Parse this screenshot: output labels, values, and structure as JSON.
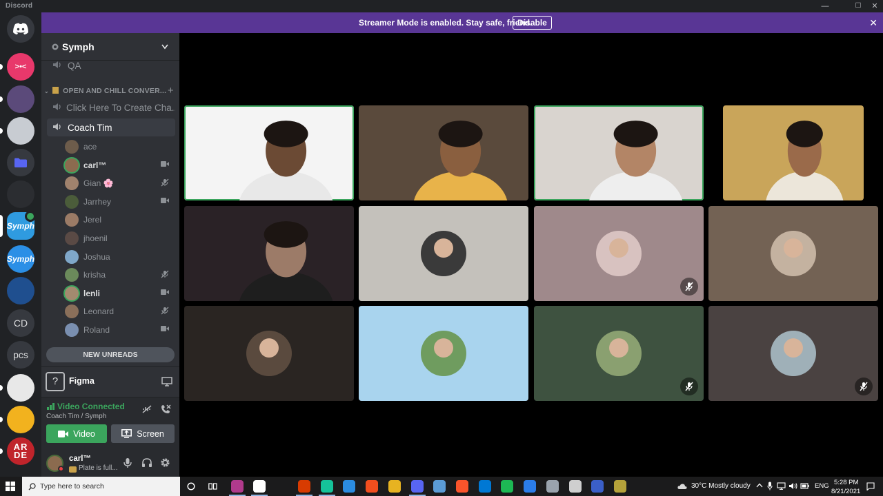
{
  "window": {
    "title": "Discord"
  },
  "banner": {
    "message": "Streamer Mode is enabled. Stay safe, friend.",
    "button_label": "Disable"
  },
  "rail": {
    "servers": [
      {
        "name": "Home",
        "icon": "discord-logo-icon",
        "color": "#36393f"
      },
      {
        "name": "server-pink",
        "color": "#e8386b"
      },
      {
        "name": "server-art",
        "color": "#5b4a7a"
      },
      {
        "name": "server-bird",
        "color": "#c8ccd2"
      },
      {
        "name": "server-folder",
        "icon": "folder-icon",
        "color": "#36393f"
      },
      {
        "name": "server-dark",
        "color": "#2b2d31"
      },
      {
        "name": "Symph",
        "color": "#2f9be0"
      },
      {
        "name": "Symph & friends",
        "color": "#2b8fe6"
      },
      {
        "name": "server-blue",
        "color": "#1f4f8f"
      },
      {
        "name": "CD",
        "label": "CD",
        "color": "#36393f"
      },
      {
        "name": "pcs",
        "label": "pcs",
        "color": "#36393f"
      },
      {
        "name": "server-circle",
        "color": "#e8e8e8"
      },
      {
        "name": "server-yellow",
        "color": "#f2b21e"
      },
      {
        "name": "ARDE",
        "label": "AR DE",
        "color": "#c0242b"
      }
    ]
  },
  "sidebar": {
    "guild_name": "Symph",
    "channel_qa": "QA",
    "category": "OPEN AND CHILL CONVER...",
    "channel_create": "Click Here To Create Cha...",
    "channel_active": "Coach Tim",
    "members": [
      {
        "name": "ace",
        "status": "none",
        "color": "#6d5c4b"
      },
      {
        "name": "carl™",
        "status": "video",
        "live": true,
        "color": "#8b6b4f"
      },
      {
        "name": "Gian 🌸",
        "status": "muted",
        "color": "#a0826d"
      },
      {
        "name": "Jarrhey",
        "status": "video",
        "color": "#4b5c3a"
      },
      {
        "name": "Jerel",
        "status": "none",
        "color": "#9b7b66"
      },
      {
        "name": "jhoenil",
        "status": "none",
        "color": "#5a4a45"
      },
      {
        "name": "Joshua",
        "status": "none",
        "color": "#7fa7c9"
      },
      {
        "name": "krisha",
        "status": "muted",
        "color": "#6b8a5b"
      },
      {
        "name": "lenli",
        "status": "video",
        "live": true,
        "color": "#a38a6f"
      },
      {
        "name": "Leonard",
        "status": "muted",
        "color": "#8a6f5a"
      },
      {
        "name": "Roland",
        "status": "video",
        "color": "#7a8fb0"
      }
    ],
    "new_unreads": "NEW UNREADS",
    "activity": {
      "name": "Figma"
    },
    "voice": {
      "status": "Video Connected",
      "location": "Coach Tim / Symph",
      "video_label": "Video",
      "screen_label": "Screen"
    },
    "user": {
      "name": "carl™",
      "custom_status": "Plate is full..."
    }
  },
  "tiles": [
    {
      "kind": "camera",
      "speaking": true,
      "bg": "#f4f4f4",
      "skin": "#6b4a34",
      "shirt": "#e8e8e8"
    },
    {
      "kind": "camera",
      "speaking": false,
      "bg": "#5a4a3c",
      "skin": "#8a5f3f",
      "shirt": "#e8b34a"
    },
    {
      "kind": "camera",
      "speaking": true,
      "bg": "#d9d4cf",
      "skin": "#b38566",
      "shirt": "#eeeeee"
    },
    {
      "kind": "camera",
      "speaking": false,
      "bg": "#c9a55a",
      "skin": "#9a6a4a",
      "shirt": "#ece6da"
    },
    {
      "kind": "camera",
      "speaking": false,
      "bg": "#2a2226",
      "skin": "#9c7b68",
      "shirt": "#1e1e1e"
    },
    {
      "kind": "avatar",
      "bg": "#c4c1bb",
      "avatar": "#3a3a3a",
      "muted": false
    },
    {
      "kind": "avatar",
      "bg": "#9f898b",
      "avatar": "#d8c2c0",
      "muted": true
    },
    {
      "kind": "avatar",
      "bg": "#736254",
      "avatar": "#c4b2a0",
      "muted": false
    },
    {
      "kind": "avatar",
      "bg": "#2a2522",
      "avatar": "#5a4a3e",
      "muted": false
    },
    {
      "kind": "avatar",
      "bg": "#a9d4ee",
      "avatar": "#6f9c5f",
      "muted": false
    },
    {
      "kind": "avatar",
      "bg": "#3e5240",
      "avatar": "#8aa070",
      "muted": true
    },
    {
      "kind": "avatar",
      "bg": "#4a4241",
      "avatar": "#9fb0b8",
      "muted": true
    }
  ],
  "taskbar": {
    "search_placeholder": "Type here to search",
    "apps": [
      {
        "name": "app-1",
        "color": "#b03a8c"
      },
      {
        "name": "notion",
        "color": "#ffffff"
      },
      {
        "name": "office",
        "color": "#d83b01"
      },
      {
        "name": "grammarly",
        "color": "#15c39a"
      },
      {
        "name": "vscode",
        "color": "#2b8ce0"
      },
      {
        "name": "figma",
        "color": "#f24e1e"
      },
      {
        "name": "chrome",
        "color": "#e7b321"
      },
      {
        "name": "discord",
        "color": "#5865f2"
      },
      {
        "name": "app-9",
        "color": "#5b9bd5"
      },
      {
        "name": "brave",
        "color": "#fb542b"
      },
      {
        "name": "mail",
        "color": "#0078d4"
      },
      {
        "name": "spotify",
        "color": "#1db954"
      },
      {
        "name": "calendar",
        "color": "#2b7de9"
      },
      {
        "name": "app-14",
        "color": "#9aa3ad"
      },
      {
        "name": "app-15",
        "color": "#cfcfcf"
      },
      {
        "name": "app-16",
        "color": "#3b5fc8"
      },
      {
        "name": "app-17",
        "color": "#b5a23a"
      }
    ],
    "weather": "30°C  Mostly cloudy",
    "lang": "ENG",
    "time": "5:28 PM",
    "date": "8/21/2021"
  },
  "colors": {
    "accent_green": "#3ba55d",
    "banner_purple": "#593695",
    "sidebar_bg": "#2f3136",
    "rail_bg": "#202225"
  }
}
